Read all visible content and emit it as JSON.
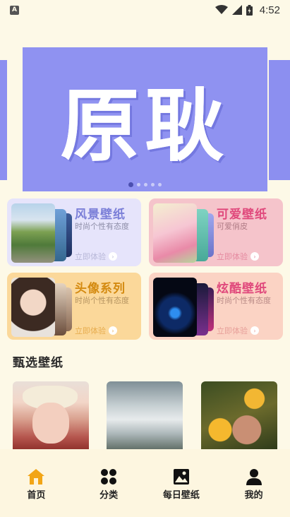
{
  "status_bar": {
    "notification_icon": "a-icon",
    "notification_letter": "A",
    "time": "4:52",
    "icons": [
      "wifi-icon",
      "signal-icon",
      "battery-icon"
    ]
  },
  "banner": {
    "title": "原耿",
    "colors": {
      "background": "#8f92f1",
      "text": "#ffffff"
    },
    "slide_count": 5,
    "active_slide": 1
  },
  "categories": [
    {
      "title": "风景壁纸",
      "subtitle": "时尚个性有态度",
      "cta": "立即体验",
      "title_color": "#7b7fd8",
      "bg": "#e6e4fb"
    },
    {
      "title": "可爱壁纸",
      "subtitle": "可爱俏皮",
      "cta": "立即体验",
      "title_color": "#e0497c",
      "bg": "#f5c4cb"
    },
    {
      "title": "头像系列",
      "subtitle": "时尚个性有态度",
      "cta": "立即体验",
      "title_color": "#d48a10",
      "bg": "#fbd89a"
    },
    {
      "title": "炫酷壁纸",
      "subtitle": "时尚个性有态度",
      "cta": "立即体验",
      "title_color": "#e0497c",
      "bg": "#fbd3c4"
    }
  ],
  "featured": {
    "title": "甄选壁纸",
    "items": [
      "portrait-with-bow",
      "clouds-landscape",
      "yellow-flowers"
    ]
  },
  "bottom_nav": {
    "items": [
      {
        "label": "首页",
        "icon": "home-icon",
        "active": true
      },
      {
        "label": "分类",
        "icon": "grid-icon",
        "active": false
      },
      {
        "label": "每日壁纸",
        "icon": "image-icon",
        "active": false
      },
      {
        "label": "我的",
        "icon": "person-icon",
        "active": false
      }
    ]
  }
}
